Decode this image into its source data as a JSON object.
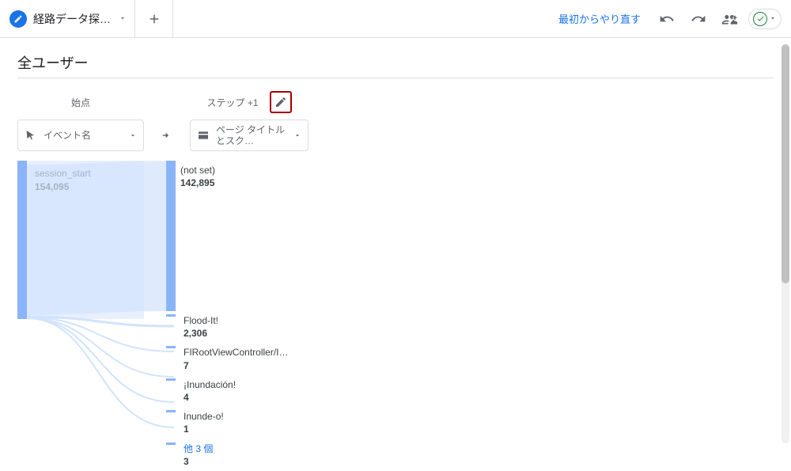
{
  "header": {
    "tab_title": "経路データ探…",
    "start_over": "最初からやり直す"
  },
  "title": "全ユーザー",
  "columns": {
    "start_label": "始点",
    "step_label": "ステップ +1"
  },
  "dimensions": {
    "start": "イベント名",
    "step": "ページ タイトルとスク…"
  },
  "flow": {
    "source": {
      "name": "session_start",
      "value": "154,095"
    },
    "targets": [
      {
        "name": "(not set)",
        "value": "142,895"
      },
      {
        "name": "Flood-It!",
        "value": "2,306"
      },
      {
        "name": "FIRootViewController/I…",
        "value": "7"
      },
      {
        "name": "¡Inundación!",
        "value": "4"
      },
      {
        "name": "Inunde-o!",
        "value": "1"
      },
      {
        "name": "他 3 個",
        "value": "3",
        "more": true
      }
    ]
  }
}
